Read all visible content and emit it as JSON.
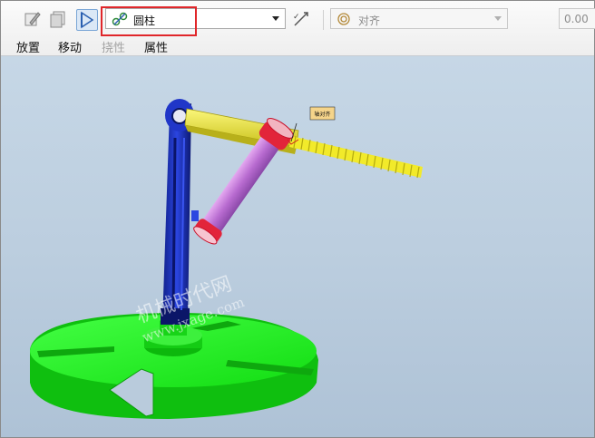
{
  "toolbar": {
    "constraint_type": "圆柱",
    "alignment": "对齐",
    "offset_value": "0.00",
    "icons": [
      "edit-icon",
      "copy-icon",
      "flip-constraint-icon",
      "cylinder-connection-icon",
      "swap-icon",
      "align-icon"
    ]
  },
  "tabs": [
    {
      "label": "放置",
      "enabled": true
    },
    {
      "label": "移动",
      "enabled": true
    },
    {
      "label": "挠性",
      "enabled": false
    },
    {
      "label": "属性",
      "enabled": true
    }
  ],
  "viewport": {
    "annotation": "轴对齐",
    "watermark_line1": "机械时代网",
    "watermark_line2": "www.jxage.com"
  },
  "colors": {
    "highlight": "#e0262a",
    "base": "#22ee22",
    "arm": "#1a2fc0",
    "beam": "#e8e232",
    "cylinder": "#c77ad9",
    "cylinder_caps": "#e0263a"
  }
}
